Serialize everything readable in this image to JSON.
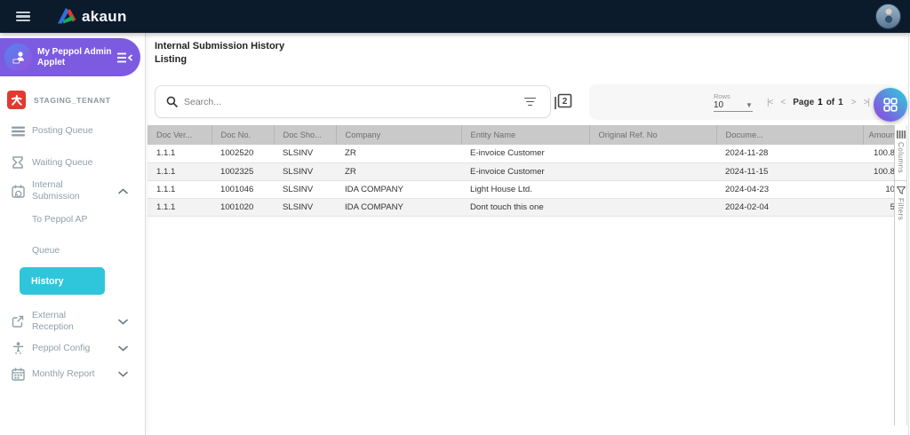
{
  "topbar": {
    "logo_text": "akaun"
  },
  "sidebar": {
    "applet": {
      "title": "My Peppol Admin Applet"
    },
    "tenant": {
      "label": "STAGING_TENANT"
    },
    "items": [
      {
        "label": "Posting Queue"
      },
      {
        "label": "Waiting Queue"
      },
      {
        "label": "Internal Submission",
        "expanded": true
      },
      {
        "label": "External Reception",
        "expanded": false
      },
      {
        "label": "Peppol Config",
        "expanded": false
      },
      {
        "label": "Monthly Report",
        "expanded": false
      }
    ],
    "submenu": [
      {
        "label": "To Peppol AP"
      },
      {
        "label": "Queue"
      },
      {
        "label": "History",
        "active": true
      }
    ]
  },
  "main": {
    "header": {
      "title": "Internal Submission History",
      "subtitle": "Listing"
    },
    "toolbar": {
      "search_placeholder": "Search...",
      "rows_label": "Rows",
      "rows_value": "10",
      "pager": {
        "first": "|<",
        "prev": "<",
        "page_label": "Page",
        "current": "1",
        "of_label": "of",
        "total": "1",
        "next": ">",
        "last": ">|"
      }
    },
    "table": {
      "columns": [
        "Doc Ver...",
        "Doc No.",
        "Doc Sho...",
        "Company",
        "Entity Name",
        "Original Ref. No",
        "Docume...",
        "Amoun"
      ],
      "rows": [
        {
          "doc_ver": "1.1.1",
          "doc_no": "1002520",
          "doc_sho": "SLSINV",
          "company": "ZR",
          "entity": "E-invoice Customer",
          "original_ref": "",
          "doc_date": "2024-11-28",
          "amount": "100.8"
        },
        {
          "doc_ver": "1.1.1",
          "doc_no": "1002325",
          "doc_sho": "SLSINV",
          "company": "ZR",
          "entity": "E-invoice Customer",
          "original_ref": "",
          "doc_date": "2024-11-15",
          "amount": "100.8"
        },
        {
          "doc_ver": "1.1.1",
          "doc_no": "1001046",
          "doc_sho": "SLSINV",
          "company": "IDA COMPANY",
          "entity": "Light House Ltd.",
          "original_ref": "",
          "doc_date": "2024-04-23",
          "amount": "10"
        },
        {
          "doc_ver": "1.1.1",
          "doc_no": "1001020",
          "doc_sho": "SLSINV",
          "company": "IDA COMPANY",
          "entity": "Dont touch this one",
          "original_ref": "",
          "doc_date": "2024-02-04",
          "amount": "5"
        }
      ]
    },
    "side_tabs": [
      {
        "label": "Columns"
      },
      {
        "label": "Filters"
      }
    ]
  },
  "colors": {
    "topbar_bg": "#0c1b2c",
    "applet_purple": "#7c5be0",
    "active_cyan": "#2fc6dc",
    "fab_gradient_start": "#2fc9dd",
    "fab_gradient_end": "#8c4be0",
    "tenant_red": "#e23a30",
    "table_header_bg": "#c9c9c9",
    "sidebar_text": "#8fa0a8"
  }
}
